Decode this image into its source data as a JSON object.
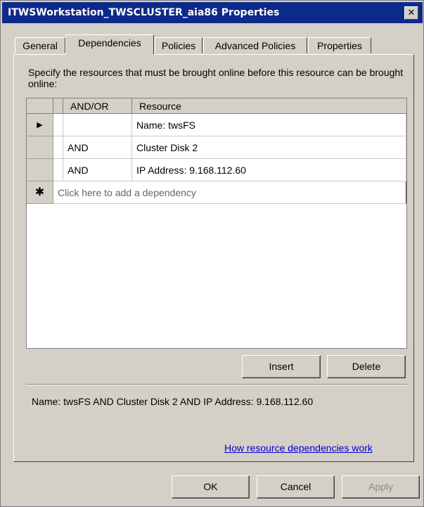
{
  "window": {
    "title": "ITWSWorkstation_TWSCLUSTER_aia86 Properties",
    "close_label": "✕"
  },
  "tabs": [
    {
      "label": "General",
      "active": false
    },
    {
      "label": "Dependencies",
      "active": true
    },
    {
      "label": "Policies",
      "active": false
    },
    {
      "label": "Advanced Policies",
      "active": false
    },
    {
      "label": "Properties",
      "active": false
    }
  ],
  "dependencies": {
    "instructions": "Specify the resources that must be brought online before this resource can be brought online:",
    "columns": {
      "andor": "AND/OR",
      "resource": "Resource"
    },
    "rows": [
      {
        "andor": "",
        "resource": "Name: twsFS",
        "selected": true
      },
      {
        "andor": "AND",
        "resource": "Cluster Disk 2",
        "selected": false
      },
      {
        "andor": "AND",
        "resource": "IP Address: 9.168.112.60",
        "selected": false
      }
    ],
    "new_row_marker": "✱",
    "new_row_placeholder": "Click here to add a dependency",
    "current_row_marker": "▶",
    "insert_label": "Insert",
    "delete_label": "Delete",
    "expression": "Name: twsFS AND Cluster Disk 2 AND IP Address: 9.168.112.60",
    "help_link": "How resource dependencies work"
  },
  "footer": {
    "ok_label": "OK",
    "cancel_label": "Cancel",
    "apply_label": "Apply",
    "apply_enabled": false
  }
}
